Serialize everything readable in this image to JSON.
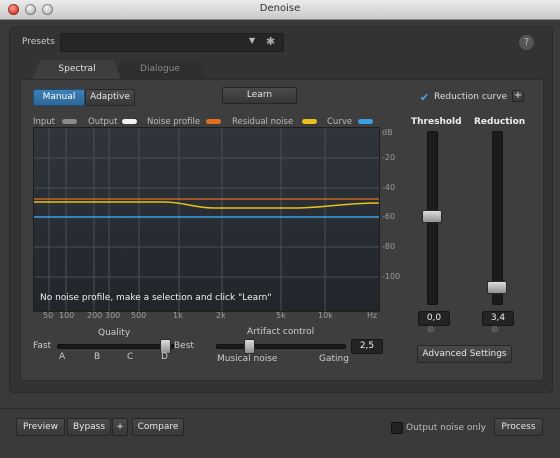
{
  "window": {
    "title": "Denoise"
  },
  "presets": {
    "label": "Presets",
    "value": "",
    "help": "?"
  },
  "tabs": [
    {
      "label": "Spectral"
    },
    {
      "label": "Dialogue"
    }
  ],
  "mode": {
    "manual": "Manual",
    "adaptive": "Adaptive",
    "selected": "Manual"
  },
  "learn_label": "Learn",
  "reduction_curve": {
    "label": "Reduction curve",
    "checked": true,
    "plus": "+"
  },
  "legend": [
    {
      "label": "Input",
      "color": "#8a8a8a"
    },
    {
      "label": "Output",
      "color": "#f2f2f2"
    },
    {
      "label": "Noise profile",
      "color": "#e07020"
    },
    {
      "label": "Residual noise",
      "color": "#e8c020"
    },
    {
      "label": "Curve",
      "color": "#3aa0e6"
    }
  ],
  "graph": {
    "db_ticks": [
      "dB",
      "-20",
      "-40",
      "-60",
      "-80",
      "-100"
    ],
    "freq_ticks": [
      "50",
      "100",
      "200",
      "300",
      "500",
      "1k",
      "2k",
      "5k",
      "10k",
      "Hz"
    ],
    "message": "No noise profile, make a selection and click \"Learn\""
  },
  "threshold": {
    "label": "Threshold",
    "value": "0,0"
  },
  "reduction": {
    "label": "Reduction",
    "value": "3,4"
  },
  "quality": {
    "label": "Quality",
    "fast": "Fast",
    "best": "Best",
    "marks": [
      "A",
      "B",
      "C",
      "D"
    ],
    "selected": "D"
  },
  "artifact": {
    "label": "Artifact control",
    "value": "2,5",
    "left": "Musical noise",
    "right": "Gating"
  },
  "advanced_label": "Advanced Settings",
  "bottom": {
    "preview": "Preview",
    "bypass": "Bypass",
    "plus": "+",
    "compare": "Compare",
    "output_noise_only": "Output noise only",
    "process": "Process"
  }
}
